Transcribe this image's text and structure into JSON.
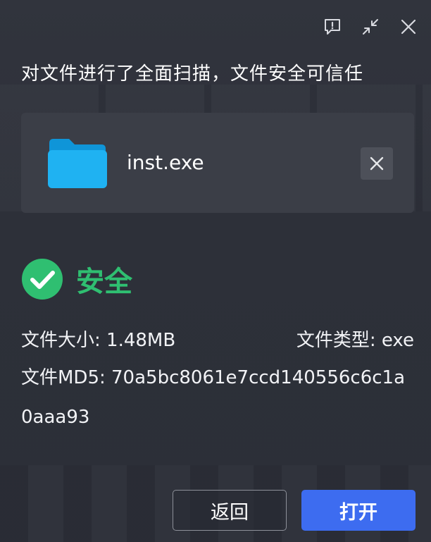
{
  "header": {
    "feedback_icon": "feedback-icon",
    "minimize_icon": "collapse-icon",
    "close_icon": "close-icon"
  },
  "headline": "对文件进行了全面扫描，文件安全可信任",
  "file": {
    "icon": "folder-icon",
    "name": "inst.exe",
    "remove_icon": "close-icon"
  },
  "status": {
    "icon": "check-circle-icon",
    "label": "安全",
    "color": "#2fbf71"
  },
  "details": {
    "size": "文件大小: 1.48MB",
    "type": "文件类型: exe",
    "md5": "文件MD5: 70a5bc8061e7ccd140556c6c1a0aaa93"
  },
  "buttons": {
    "back": "返回",
    "open": "打开"
  },
  "colors": {
    "background": "#2e313a",
    "card": "#3b3e47",
    "primary": "#3d6cf0",
    "safe": "#2fbf71",
    "folder": "#1fb2f2"
  }
}
